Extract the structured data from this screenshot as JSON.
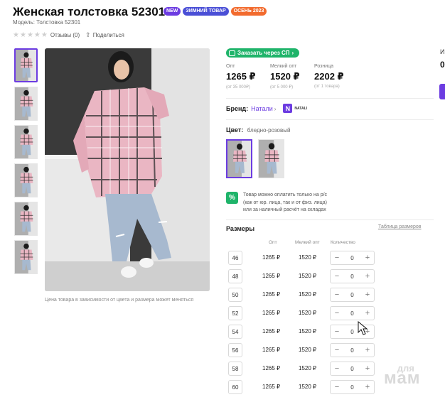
{
  "product": {
    "title": "Женская толстовка 52301",
    "badges": {
      "new": "NEW",
      "winter": "ЗИМНИЙ ТОВАР",
      "autumn": "ОСЕНЬ 2023"
    },
    "model": "Модель: Толстовка 52301",
    "reviews": "Отзывы (0)",
    "share": "Поделиться"
  },
  "gallery": {
    "thumbnail_count": 6,
    "active_thumbnail": 1,
    "note": "Цена товара в зависимости от цвета и размера может меняться"
  },
  "order": {
    "sp_button": "Заказать через СП"
  },
  "prices": [
    {
      "label": "Опт",
      "value": "1265 ₽",
      "sub": "(от 35 000₽)"
    },
    {
      "label": "Мелкий опт",
      "value": "1520 ₽",
      "sub": "(от 5 000 ₽)"
    },
    {
      "label": "Розница",
      "value": "2202 ₽",
      "sub": "(от 1 товара)"
    }
  ],
  "brand": {
    "label": "Бренд:",
    "name": "Натали",
    "logo_letter": "N",
    "logo_text": "NATALI"
  },
  "color": {
    "label": "Цвет:",
    "value": "бледно-розовый",
    "swatch_count": 2,
    "active_swatch": 1
  },
  "payment_note": {
    "icon": "%",
    "line1": "Товар можно оплатить только на р/с",
    "line2": "(как от юр. лица, так и от физ. лица)",
    "line3": "или за наличный расчёт на складах"
  },
  "sizes": {
    "title": "Размеры",
    "table_link": "Таблица размеров",
    "headers": {
      "from": "Опт",
      "wholesale": "Мелкий опт",
      "qty": "Количество"
    },
    "rows": [
      {
        "size": "46",
        "from": "1265 ₽",
        "wholesale": "1520 ₽",
        "qty": "0"
      },
      {
        "size": "48",
        "from": "1265 ₽",
        "wholesale": "1520 ₽",
        "qty": "0"
      },
      {
        "size": "50",
        "from": "1265 ₽",
        "wholesale": "1520 ₽",
        "qty": "0"
      },
      {
        "size": "52",
        "from": "1265 ₽",
        "wholesale": "1520 ₽",
        "qty": "0"
      },
      {
        "size": "54",
        "from": "1265 ₽",
        "wholesale": "1520 ₽",
        "qty": "0"
      },
      {
        "size": "56",
        "from": "1265 ₽",
        "wholesale": "1520 ₽",
        "qty": "0"
      },
      {
        "size": "58",
        "from": "1265 ₽",
        "wholesale": "1520 ₽",
        "qty": "0"
      },
      {
        "size": "60",
        "from": "1265 ₽",
        "wholesale": "1520 ₽",
        "qty": "0"
      }
    ]
  },
  "sidebar_cut": {
    "line1": "И",
    "line2": "0"
  },
  "watermark": {
    "line1": "для",
    "line2": "мам"
  },
  "colors": {
    "accent": "#6c3ce1",
    "green": "#1fb46a",
    "orange": "#f26b2e"
  },
  "icons": [
    "star-icon",
    "share-icon",
    "chevron-right-icon",
    "bag-icon",
    "percent-icon",
    "minus-icon",
    "plus-icon",
    "cursor-icon"
  ]
}
